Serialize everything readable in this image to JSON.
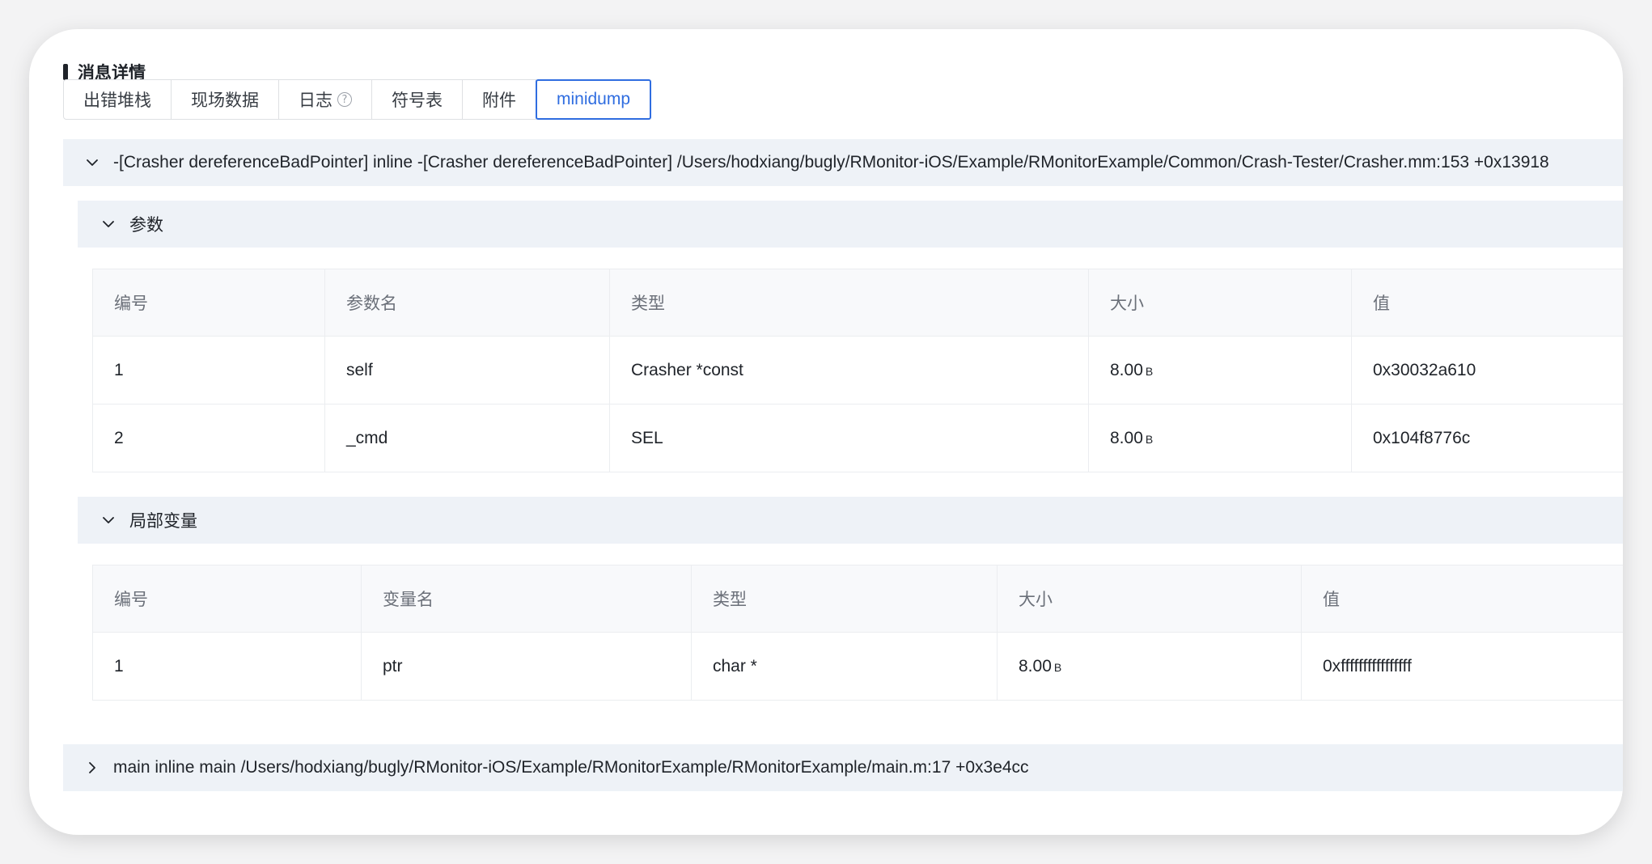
{
  "section": {
    "title": "消息详情"
  },
  "tabs": [
    {
      "label": "出错堆栈"
    },
    {
      "label": "现场数据"
    },
    {
      "label": "日志",
      "help": "?"
    },
    {
      "label": "符号表"
    },
    {
      "label": "附件"
    },
    {
      "label": "minidump",
      "active": true
    }
  ],
  "frames": [
    {
      "text": "-[Crasher dereferenceBadPointer] inline -[Crasher dereferenceBadPointer] /Users/hodxiang/bugly/RMonitor-iOS/Example/RMonitorExample/Common/Crash-Tester/Crasher.mm:153 +0x13918",
      "expanded": true,
      "params": {
        "title": "参数",
        "columns": [
          "编号",
          "参数名",
          "类型",
          "大小",
          "值"
        ],
        "rows": [
          {
            "index": "1",
            "name": "self",
            "type": "Crasher *const",
            "size": "8.00",
            "unit": "B",
            "value": "0x30032a610"
          },
          {
            "index": "2",
            "name": "_cmd",
            "type": "SEL",
            "size": "8.00",
            "unit": "B",
            "value": "0x104f8776c"
          }
        ]
      },
      "locals": {
        "title": "局部变量",
        "columns": [
          "编号",
          "变量名",
          "类型",
          "大小",
          "值"
        ],
        "rows": [
          {
            "index": "1",
            "name": "ptr",
            "type": "char *",
            "size": "8.00",
            "unit": "B",
            "value": "0xffffffffffffffff"
          }
        ]
      }
    },
    {
      "text": "main inline main /Users/hodxiang/bugly/RMonitor-iOS/Example/RMonitorExample/RMonitorExample/main.m:17 +0x3e4cc",
      "expanded": false
    }
  ]
}
